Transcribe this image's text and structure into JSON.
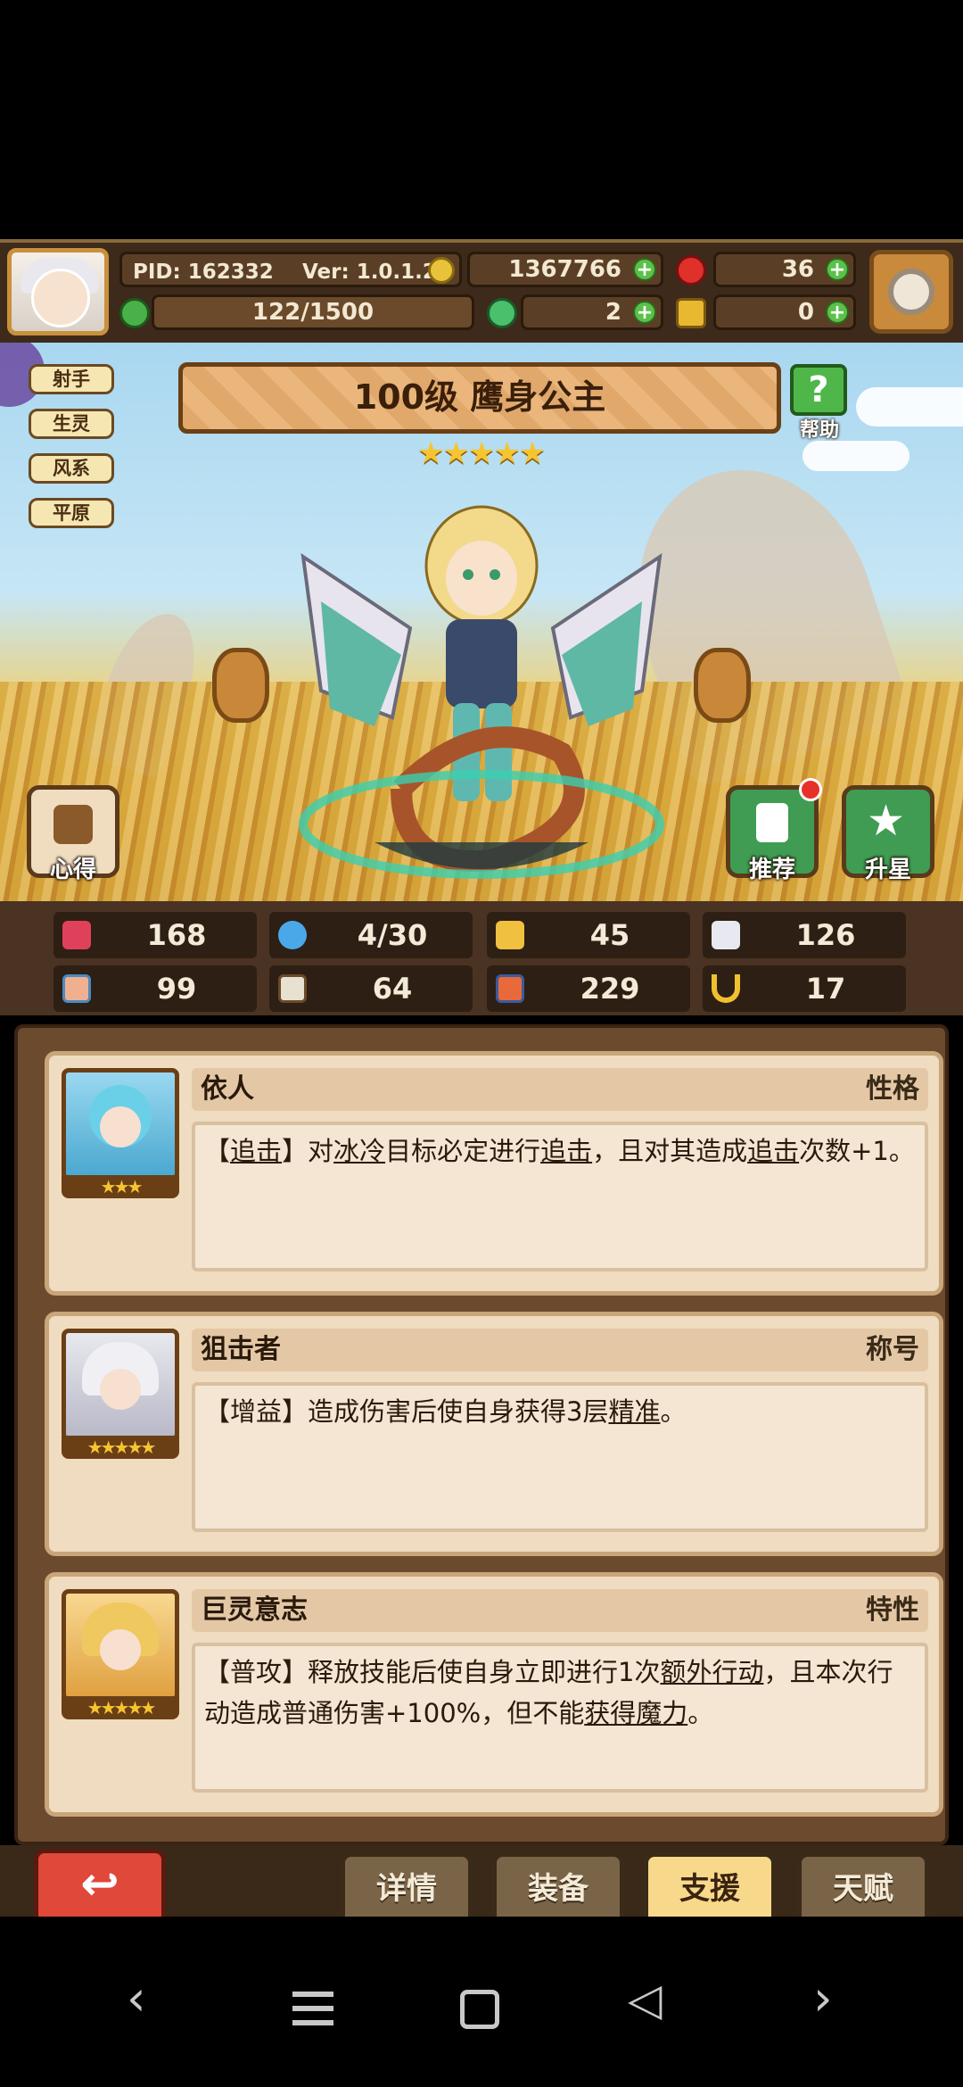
{
  "hud": {
    "pid": "PID: 162332",
    "ver": "Ver: 1.0.1.2",
    "gold": "1367766",
    "gems": "36",
    "stamina": "122/1500",
    "clover": "2",
    "keys": "0"
  },
  "tags": [
    "射手",
    "生灵",
    "风系",
    "平原"
  ],
  "hero": {
    "title": "100级 鹰身公主",
    "stars": "★★★★★"
  },
  "buttons": {
    "help": "帮助",
    "heart": "心得",
    "recommend": "推荐",
    "star_up": "升星"
  },
  "stats": [
    {
      "icon": "heart-icon",
      "value": "168",
      "color": "#e0415a"
    },
    {
      "icon": "water-drop-icon",
      "value": "4/30",
      "color": "#4aa8e8"
    },
    {
      "icon": "shield-icon",
      "value": "45",
      "color": "#f0c040"
    },
    {
      "icon": "wing-icon",
      "value": "126",
      "color": "#e8e8f0"
    },
    {
      "icon": "fist-icon",
      "value": "99",
      "color": "#f0b090"
    },
    {
      "icon": "book-icon",
      "value": "64",
      "color": "#e8e0d0"
    },
    {
      "icon": "magic-book-icon",
      "value": "229",
      "color": "#e86a3a"
    },
    {
      "icon": "horseshoe-icon",
      "value": "17",
      "color": "#f0c030"
    }
  ],
  "cards": [
    {
      "name": "依人",
      "type": "性格",
      "stars": "★★★",
      "desc_segments": [
        {
          "t": "【"
        },
        {
          "t": "追击",
          "u": true
        },
        {
          "t": "】对"
        },
        {
          "t": "冰冷",
          "u": true
        },
        {
          "t": "目标必定进行"
        },
        {
          "t": "追击",
          "u": true
        },
        {
          "t": "，且对其造成"
        },
        {
          "t": "追击",
          "u": true
        },
        {
          "t": "次数+1。"
        }
      ]
    },
    {
      "name": "狙击者",
      "type": "称号",
      "stars": "★★★★★",
      "desc_segments": [
        {
          "t": "【增益】造成伤害后使自身获得3层"
        },
        {
          "t": "精准",
          "u": true
        },
        {
          "t": "。"
        }
      ]
    },
    {
      "name": "巨灵意志",
      "type": "特性",
      "stars": "★★★★★",
      "desc_segments": [
        {
          "t": "【普攻】释放技能后使自身立即进行1次"
        },
        {
          "t": "额外行动",
          "u": true
        },
        {
          "t": "，且本次行动造成普通伤害+100%，但不能"
        },
        {
          "t": "获得魔力",
          "u": true
        },
        {
          "t": "。"
        }
      ]
    }
  ],
  "tabs": [
    {
      "label": "详情",
      "active": false
    },
    {
      "label": "装备",
      "active": false
    },
    {
      "label": "支援",
      "active": true
    },
    {
      "label": "天赋",
      "active": false
    }
  ],
  "back_icon": "↩"
}
